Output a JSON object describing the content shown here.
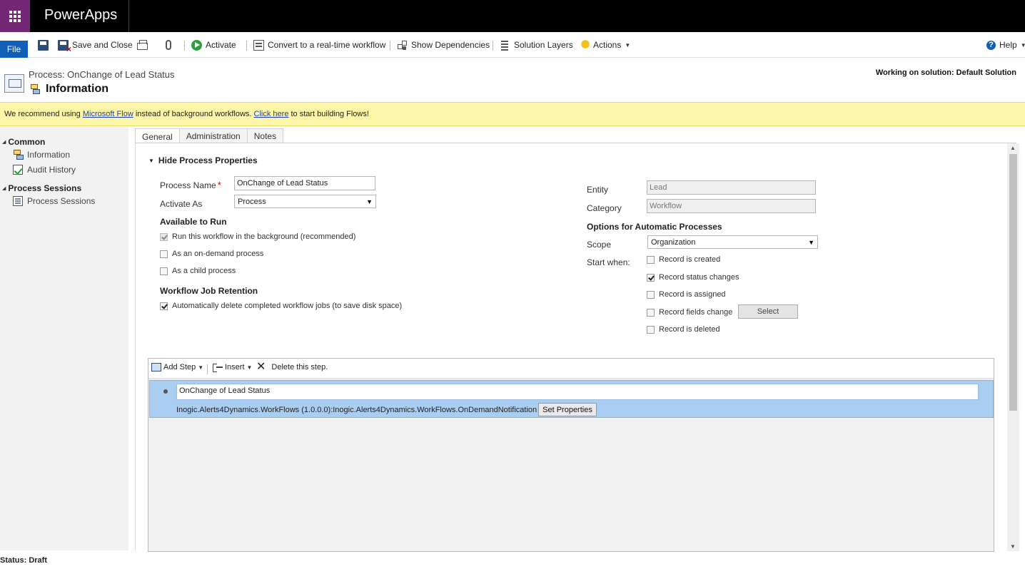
{
  "app": {
    "name": "PowerApps"
  },
  "commands": {
    "file": "File",
    "save_close": "Save and Close",
    "activate": "Activate",
    "convert": "Convert to a real-time workflow",
    "dependencies": "Show Dependencies",
    "solution_layers": "Solution Layers",
    "actions": "Actions",
    "help": "Help"
  },
  "header": {
    "process_title": "Process: OnChange of Lead Status",
    "form_title": "Information",
    "solution": "Working on solution: Default Solution"
  },
  "notice": {
    "prefix": "We recommend using ",
    "link1": "Microsoft Flow",
    "middle": " instead of background workflows. ",
    "link2": "Click here",
    "suffix": " to start building Flows!"
  },
  "nav": {
    "common": "Common",
    "information": "Information",
    "audit_history": "Audit History",
    "process_sessions_group": "Process Sessions",
    "process_sessions": "Process Sessions"
  },
  "tabs": [
    "General",
    "Administration",
    "Notes"
  ],
  "form": {
    "section_toggle": "Hide Process Properties",
    "process_name_label": "Process Name",
    "process_name_value": "OnChange of Lead Status",
    "activate_as_label": "Activate As",
    "activate_as_value": "Process",
    "available_to_run": "Available to Run",
    "run_background": "Run this workflow in the background (recommended)",
    "on_demand": "As an on-demand process",
    "child_process": "As a child process",
    "job_retention": "Workflow Job Retention",
    "auto_delete": "Automatically delete completed workflow jobs (to save disk space)",
    "entity_label": "Entity",
    "entity_value": "Lead",
    "category_label": "Category",
    "category_value": "Workflow",
    "options_auto": "Options for Automatic Processes",
    "scope_label": "Scope",
    "scope_value": "Organization",
    "start_when_label": "Start when:",
    "record_created": "Record is created",
    "record_status": "Record status changes",
    "record_assigned": "Record is assigned",
    "record_fields": "Record fields change",
    "select_btn": "Select",
    "record_deleted": "Record is deleted"
  },
  "steps": {
    "add_step": "Add Step",
    "insert": "Insert",
    "delete": "Delete this step.",
    "step_name": "OnChange of Lead Status",
    "step_desc": "Inogic.Alerts4Dynamics.WorkFlows (1.0.0.0):Inogic.Alerts4Dynamics.WorkFlows.OnDemandNotification",
    "set_properties": "Set Properties"
  },
  "status": "Status: Draft",
  "colors": {
    "topbar": "#000000",
    "waffle": "#742774",
    "file_button": "#1160b7",
    "notice_bg": "#fdf6a8",
    "step_selected": "#aacdf2"
  }
}
